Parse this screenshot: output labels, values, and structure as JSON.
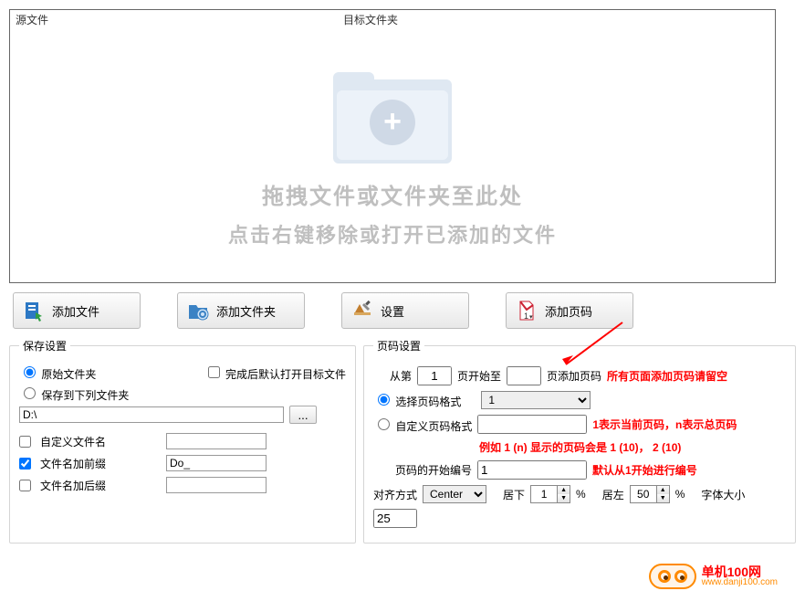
{
  "dropzone": {
    "col_source": "源文件",
    "col_target": "目标文件夹",
    "line1": "拖拽文件或文件夹至此处",
    "line2": "点击右键移除或打开已添加的文件"
  },
  "toolbar": {
    "add_file": "添加文件",
    "add_folder": "添加文件夹",
    "settings": "设置",
    "add_page_number": "添加页码"
  },
  "save": {
    "legend": "保存设置",
    "open_target_after_done": "完成后默认打开目标文件",
    "original_folder": "原始文件夹",
    "save_to_folder": "保存到下列文件夹",
    "path_value": "D:\\",
    "custom_filename": "自定义文件名",
    "add_prefix": "文件名加前缀",
    "add_suffix": "文件名加后缀",
    "prefix_value": "Do_",
    "custom_filename_val": "",
    "suffix_value": ""
  },
  "page": {
    "legend": "页码设置",
    "from_label": "从第",
    "from_value": "1",
    "page_start_to": "页开始至",
    "to_value": "",
    "page_add_pn": "页添加页码",
    "hint_all_pages": "所有页面添加页码请留空",
    "select_format": "选择页码格式",
    "format_options": [
      "1"
    ],
    "format_value": "1",
    "custom_format": "自定义页码格式",
    "custom_value": "",
    "hint_1n": "1表示当前页码，n表示总页码",
    "hint_example": "例如 1 (n) 显示的页码会是  1 (10)， 2 (10)",
    "start_number_label": "页码的开始编号",
    "start_number_value": "1",
    "hint_default_start": "默认从1开始进行编号",
    "align_label": "对齐方式",
    "align_options": [
      "Center"
    ],
    "align_value": "Center",
    "margin_bottom_label": "居下",
    "margin_bottom_value": "1",
    "pct": "%",
    "margin_left_label": "居左",
    "margin_left_value": "50",
    "font_size_label": "字体大小",
    "font_size_value": "25"
  },
  "branding": {
    "site_cn": "单机100网",
    "site_en": "www.danji100.com"
  }
}
